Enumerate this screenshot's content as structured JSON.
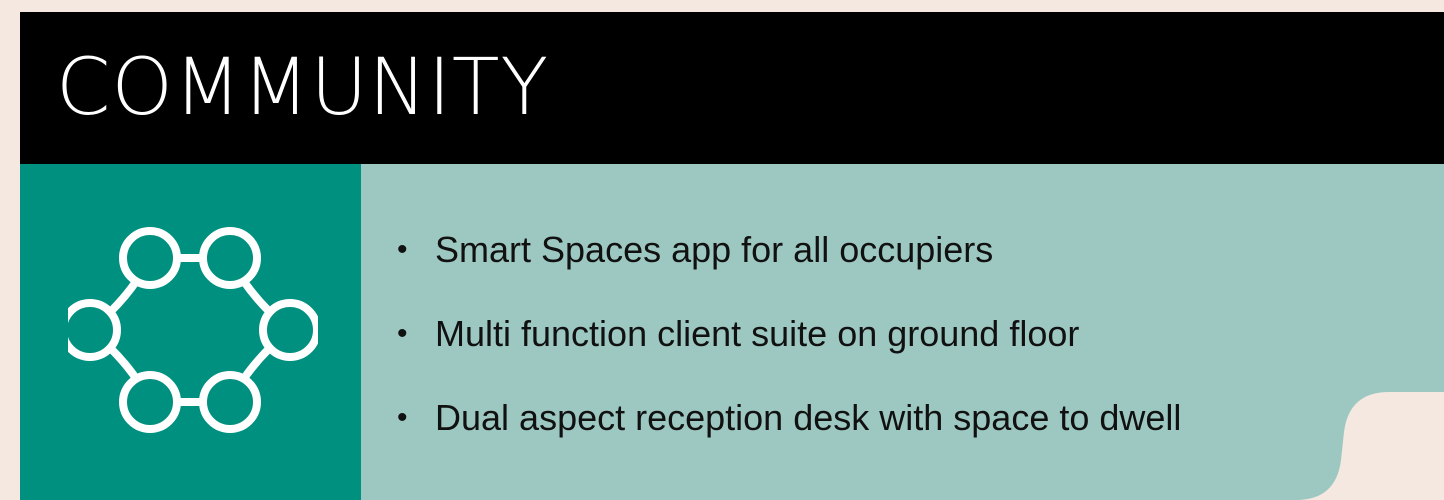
{
  "header": {
    "title": "COMMUNITY"
  },
  "icon": {
    "name": "community-network-icon",
    "color": "#ffffff"
  },
  "bullets": [
    "Smart Spaces app for all occupiers",
    "Multi function client suite on ground floor",
    "Dual aspect reception desk with space to dwell"
  ],
  "colors": {
    "background": "#f4e8e1",
    "header": "#000000",
    "icon_panel": "#009080",
    "content_panel": "#9cc8c1",
    "text": "#111111"
  }
}
